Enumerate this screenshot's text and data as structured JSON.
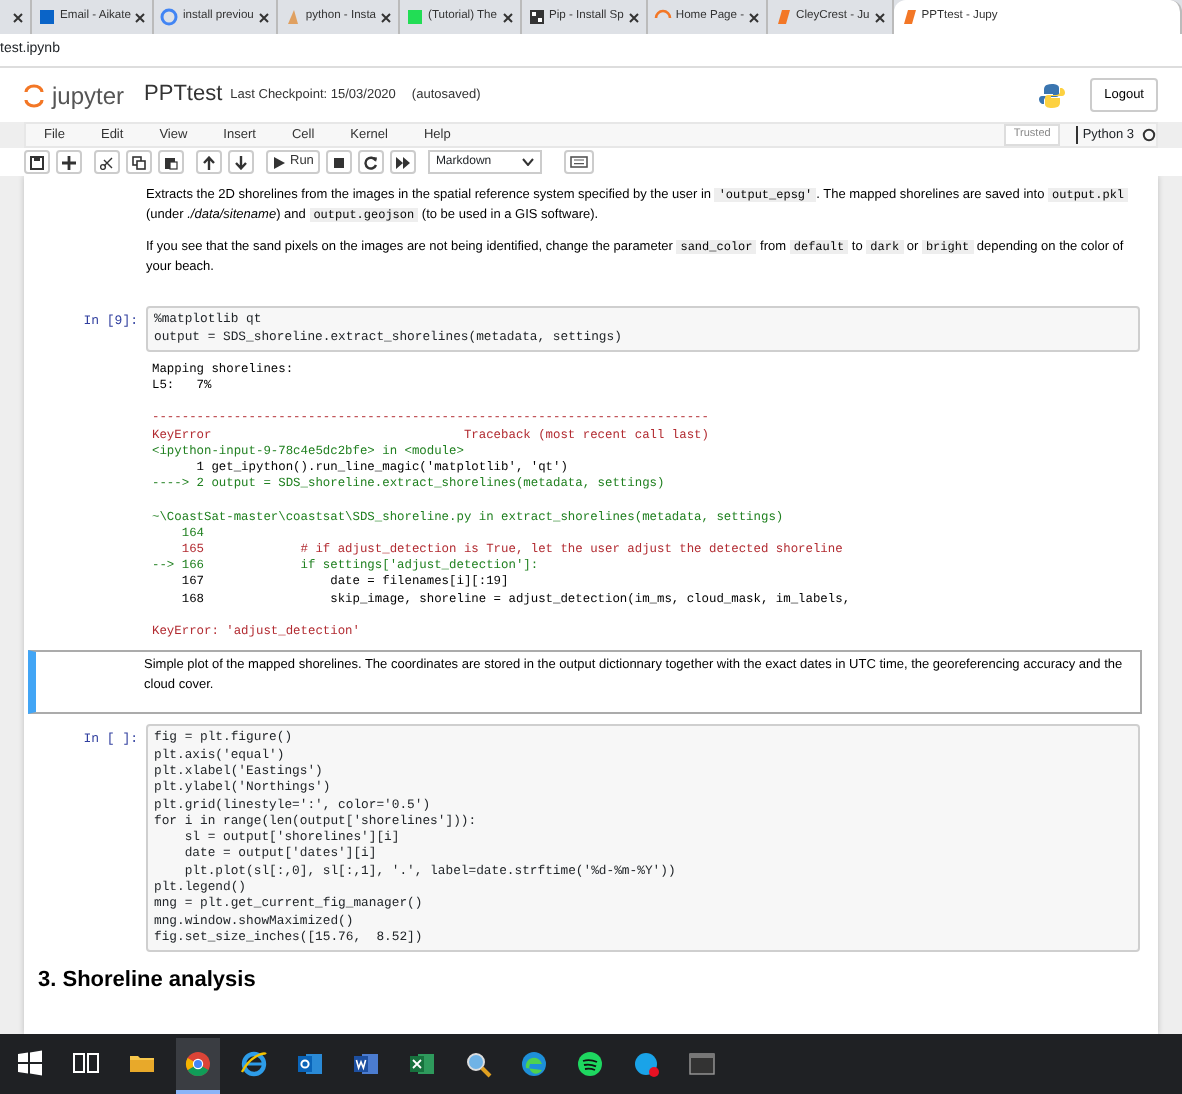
{
  "browser_tabs": [
    {
      "selected": false
    },
    {
      "title": "Email - Aikate",
      "selected": false
    },
    {
      "title": "install previou",
      "selected": false
    },
    {
      "title": "python - Insta",
      "selected": false
    },
    {
      "title": "(Tutorial) The",
      "selected": false
    },
    {
      "title": "Pip - Install Sp",
      "selected": false
    },
    {
      "title": "Home Page - ",
      "selected": false
    },
    {
      "title": "CleyCrest - Ju",
      "selected": false
    },
    {
      "title": "PPTtest - Jupy",
      "selected": true
    }
  ],
  "address": "test.ipynb",
  "header": {
    "logo": "jupyter",
    "notebook": "PPTtest",
    "checkpoint": "Last Checkpoint: 15/03/2020",
    "autosave": "(autosaved)",
    "logout": "Logout"
  },
  "menu": [
    "File",
    "Edit",
    "View",
    "Insert",
    "Cell",
    "Kernel",
    "Help"
  ],
  "trusted": "Trusted",
  "kernel": "Python 3",
  "toolbar": {
    "run": "Run",
    "cell_type": "Markdown"
  },
  "cells": [
    {
      "kind": "markdown",
      "selected": false,
      "paragraphs": [
        [
          {
            "t": "Extracts the 2D shorelines from the images in the spatial reference system specified by the user in "
          },
          {
            "t": "'output_epsg'",
            "code": true
          },
          {
            "t": ". The mapped shorelines are saved into "
          },
          {
            "t": "output.pkl",
            "code": true
          },
          {
            "t": " (under "
          },
          {
            "t": "./data/sitename",
            "em": true
          },
          {
            "t": ") and "
          },
          {
            "t": "output.geojson",
            "code": true
          },
          {
            "t": " (to be used in a GIS software)."
          }
        ],
        [
          {
            "t": "If you see that the sand pixels on the images are not being identified, change the parameter "
          },
          {
            "t": "sand_color",
            "code": true
          },
          {
            "t": " from "
          },
          {
            "t": "default",
            "code": true
          },
          {
            "t": " to "
          },
          {
            "t": "dark",
            "code": true
          },
          {
            "t": " or "
          },
          {
            "t": "bright",
            "code": true
          },
          {
            "t": " depending on the color of your beach."
          }
        ]
      ]
    },
    {
      "kind": "code",
      "selected": false,
      "prompt": "In [9]:",
      "source": [
        "%matplotlib qt",
        "output = SDS_shoreline.extract_shorelines(metadata, settings)"
      ],
      "output": [
        {
          "kind": "plain",
          "text": "Mapping shorelines:"
        },
        {
          "kind": "plain",
          "text": "L5:   7%"
        },
        {
          "kind": "blank"
        },
        {
          "kind": "rule",
          "text": "---------------------------------------------------------------------------"
        },
        {
          "kind": "error",
          "text": "KeyError                                  Traceback (most recent call last)"
        },
        {
          "kind": "location",
          "text": "<ipython-input-9-78c4e5dc2bfe> in <module>"
        },
        {
          "kind": "plain",
          "text": "      1 get_ipython().run_line_magic('matplotlib', 'qt')"
        },
        {
          "kind": "arrow",
          "text": "----> 2 output = SDS_shoreline.extract_shorelines(metadata, settings)"
        },
        {
          "kind": "blank"
        },
        {
          "kind": "location",
          "text": "~\\CoastSat-master\\coastsat\\SDS_shoreline.py in extract_shorelines(metadata, settings)"
        },
        {
          "kind": "lineno",
          "text": "    164 "
        },
        {
          "kind": "comment",
          "text": "    165             # if adjust_detection is True, let the user adjust the detected shoreline"
        },
        {
          "kind": "arrow",
          "text": "--> 166             if settings['adjust_detection']:"
        },
        {
          "kind": "plain",
          "text": "    167                 date = filenames[i][:19]"
        },
        {
          "kind": "plain",
          "text": "    168                 skip_image, shoreline = adjust_detection(im_ms, cloud_mask, im_labels,"
        },
        {
          "kind": "blank"
        },
        {
          "kind": "error",
          "text": "KeyError: 'adjust_detection'"
        }
      ]
    },
    {
      "kind": "markdown",
      "selected": true,
      "paragraphs": [
        [
          {
            "t": "Simple plot of the mapped shorelines. The coordinates are stored in the output dictionnary together with the exact dates in UTC time, the georeferencing accuracy and the cloud cover."
          }
        ]
      ]
    },
    {
      "kind": "code",
      "selected": false,
      "prompt": "In [ ]:",
      "source": [
        "fig = plt.figure()",
        "plt.axis('equal')",
        "plt.xlabel('Eastings')",
        "plt.ylabel('Northings')",
        "plt.grid(linestyle=':', color='0.5')",
        "for i in range(len(output['shorelines'])):",
        "    sl = output['shorelines'][i]",
        "    date = output['dates'][i]",
        "    plt.plot(sl[:,0], sl[:,1], '.', label=date.strftime('%d-%m-%Y'))",
        "plt.legend()",
        "mng = plt.get_current_fig_manager()",
        "mng.window.showMaximized()",
        "fig.set_size_inches([15.76,  8.52])"
      ]
    },
    {
      "kind": "heading",
      "selected": false,
      "text": "3. Shoreline analysis"
    }
  ],
  "taskbar": [
    {
      "kind": "start"
    },
    {
      "kind": "taskview"
    },
    {
      "kind": "folder"
    },
    {
      "kind": "chrome",
      "selected": true
    },
    {
      "kind": "ie"
    },
    {
      "kind": "outlook"
    },
    {
      "kind": "word"
    },
    {
      "kind": "excel"
    },
    {
      "kind": "magnifier"
    },
    {
      "kind": "edge"
    },
    {
      "kind": "spotify"
    },
    {
      "kind": "skype"
    },
    {
      "kind": "terminal"
    }
  ]
}
